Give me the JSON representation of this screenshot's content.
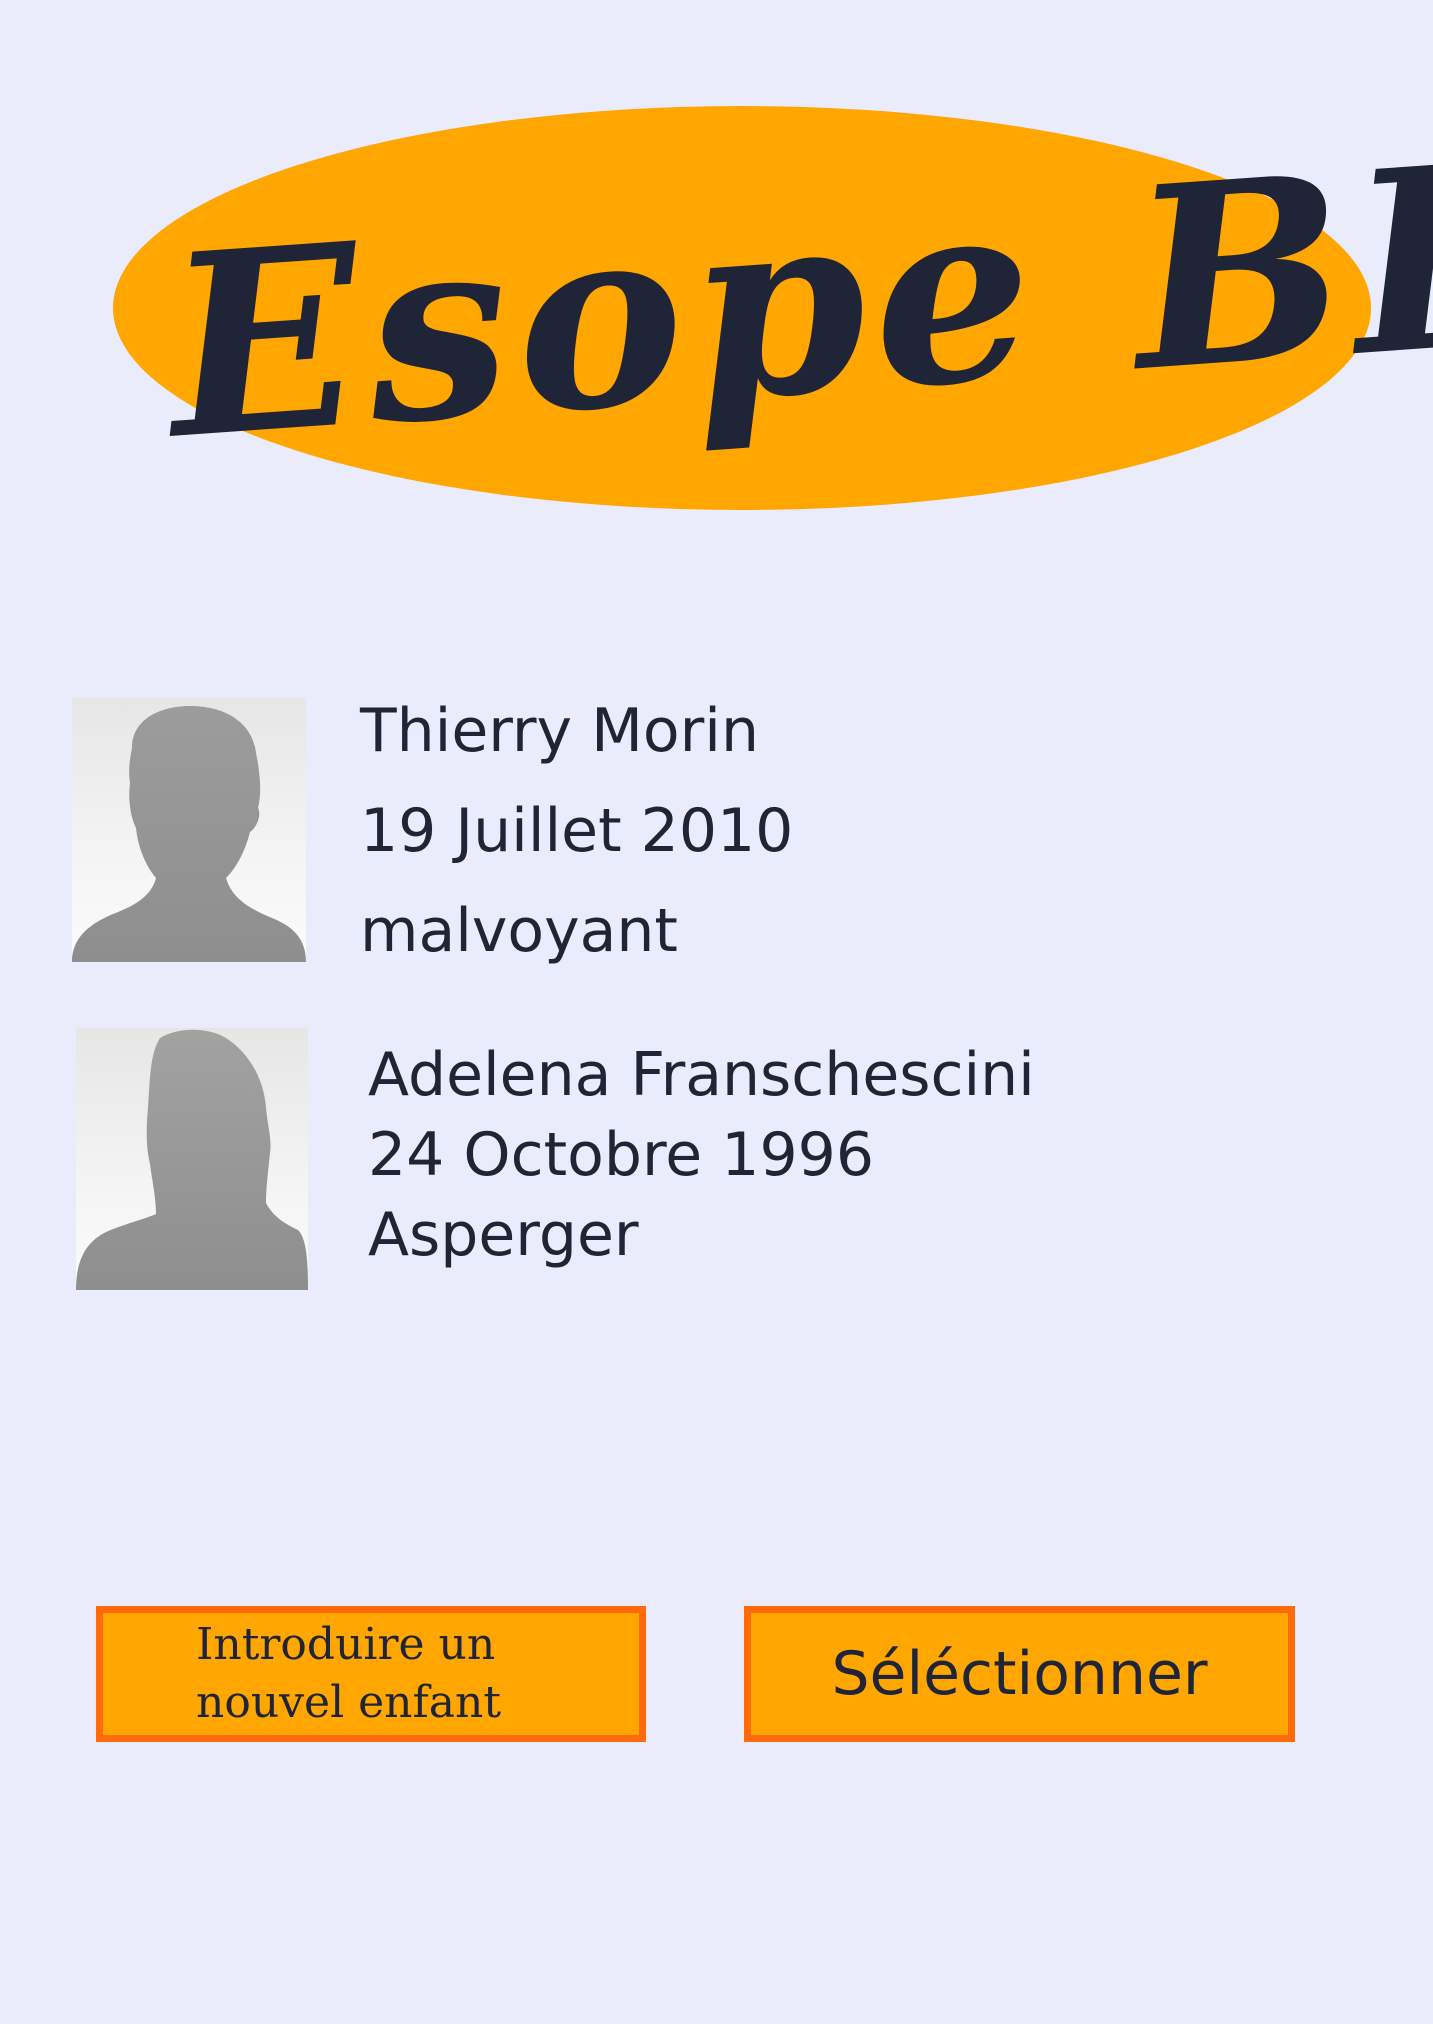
{
  "app": {
    "logo_text": "Esope BD",
    "colors": {
      "background": "#eaebfb",
      "logo_ellipse": "#ffa600",
      "button_fill": "#ffa600",
      "button_border": "#ff6a0a",
      "text": "#1f2436"
    }
  },
  "children": [
    {
      "avatar_icon": "person-silhouette-icon",
      "name": "Thierry Morin",
      "birth_date": "19 Juillet 2010",
      "condition": "malvoyant"
    },
    {
      "avatar_icon": "person-silhouette-icon",
      "name": "Adelena Franschescini",
      "birth_date": "24 Octobre 1996",
      "condition": "Asperger"
    }
  ],
  "actions": {
    "add_child_label_line1": "Introduire un",
    "add_child_label_line2": "nouvel enfant",
    "select_label": "Séléctionner"
  }
}
